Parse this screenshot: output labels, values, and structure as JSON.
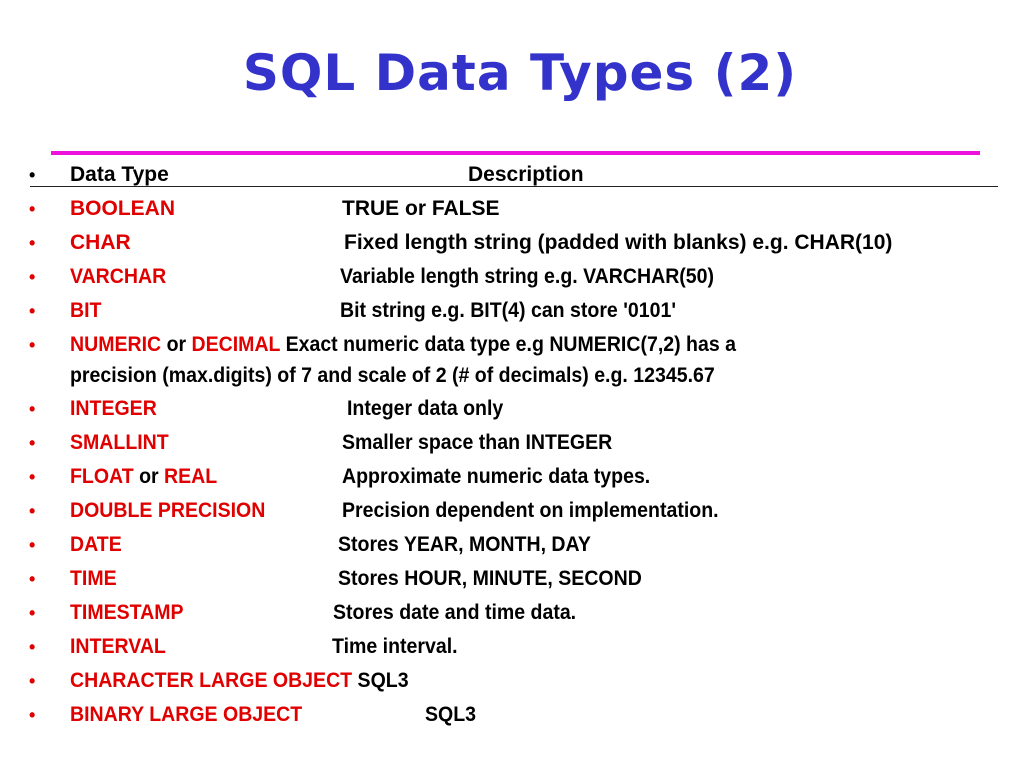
{
  "slide": {
    "title": "SQL Data Types (2)",
    "colors": {
      "title": "#3333cc",
      "rule": "#ee11dd",
      "type_name": "#e00000",
      "text": "#000000"
    },
    "header": {
      "bullet": "•",
      "col_type": "Data Type",
      "col_description": "Description"
    },
    "rows": [
      {
        "bullet": "•",
        "type": "BOOLEAN",
        "description": "TRUE or FALSE"
      },
      {
        "bullet": "•",
        "type": "CHAR",
        "description": "Fixed length string (padded with blanks) e.g. CHAR(10)"
      },
      {
        "bullet": "•",
        "type": "VARCHAR",
        "description": "Variable length string e.g. VARCHAR(50)"
      },
      {
        "bullet": "•",
        "type": "BIT",
        "description": "Bit string e.g. BIT(4) can store '0101'"
      },
      {
        "bullet": "•",
        "type_a": "NUMERIC",
        "joiner": " or ",
        "type_b": "DECIMAL",
        "description_line1": "Exact numeric data type e.g NUMERIC(7,2) has a",
        "description_line2": "precision (max.digits) of 7 and scale of 2 (# of decimals) e.g. 12345.67"
      },
      {
        "bullet": "•",
        "type": "INTEGER",
        "description": "Integer data only"
      },
      {
        "bullet": "•",
        "type": "SMALLINT",
        "description": "Smaller space than INTEGER"
      },
      {
        "bullet": "•",
        "type_a": "FLOAT",
        "joiner": " or ",
        "type_b": "REAL",
        "description": "Approximate numeric data types."
      },
      {
        "bullet": "•",
        "type": "DOUBLE PRECISION",
        "description": "Precision dependent on implementation."
      },
      {
        "bullet": "•",
        "type": "DATE",
        "description": "Stores YEAR, MONTH, DAY"
      },
      {
        "bullet": "•",
        "type": "TIME",
        "description": "Stores HOUR, MINUTE, SECOND"
      },
      {
        "bullet": "•",
        "type": "TIMESTAMP",
        "description": "Stores date and time data."
      },
      {
        "bullet": "•",
        "type": "INTERVAL",
        "description": "Time interval."
      },
      {
        "bullet": "•",
        "type": "CHARACTER LARGE OBJECT",
        "description": "SQL3"
      },
      {
        "bullet": "•",
        "type": "BINARY LARGE OBJECT",
        "description": "SQL3"
      }
    ]
  }
}
